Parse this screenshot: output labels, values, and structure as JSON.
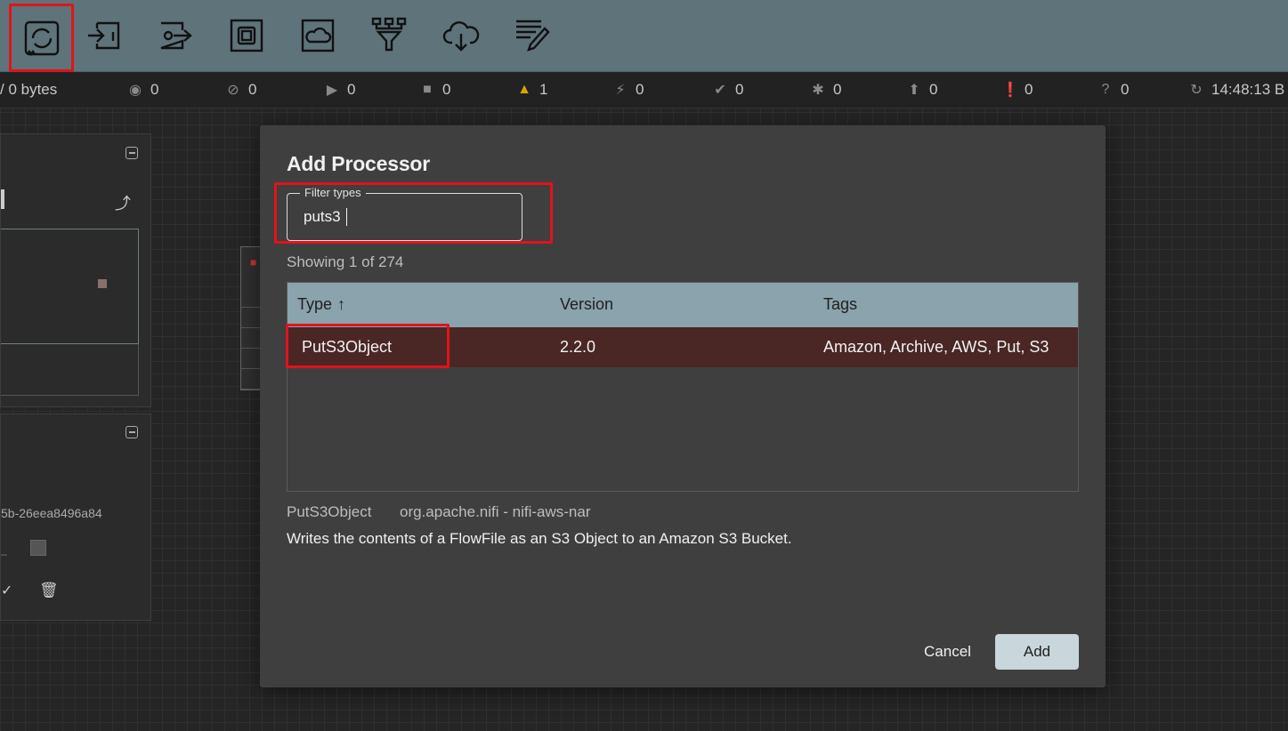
{
  "toolbar": {
    "tools": [
      {
        "name": "processor-icon",
        "selected": true
      },
      {
        "name": "input-port-icon"
      },
      {
        "name": "output-port-icon"
      },
      {
        "name": "process-group-icon"
      },
      {
        "name": "remote-process-group-icon"
      },
      {
        "name": "funnel-icon"
      },
      {
        "name": "template-icon"
      },
      {
        "name": "label-icon"
      }
    ]
  },
  "status": {
    "bytes": "/ 0 bytes",
    "transmitting": "0",
    "not_transmitting": "0",
    "running": "0",
    "stopped": "0",
    "invalid": "1",
    "disabled": "0",
    "up_to_date": "0",
    "locally_modified": "0",
    "stale": "0",
    "errors": "0",
    "sync_failure": "0",
    "last_refreshed": "14:48:13 B"
  },
  "side": {
    "identifier": "5b-26eea8496a84"
  },
  "modal": {
    "title": "Add Processor",
    "filter_label": "Filter types",
    "filter_value": "puts3",
    "showing": "Showing 1 of 274",
    "columns": {
      "type": "Type",
      "version": "Version",
      "tags": "Tags"
    },
    "rows": [
      {
        "type": "PutS3Object",
        "version": "2.2.0",
        "tags": "Amazon, Archive, AWS, Put, S3"
      }
    ],
    "detail": {
      "type": "PutS3Object",
      "bundle": "org.apache.nifi - nifi-aws-nar",
      "description": "Writes the contents of a FlowFile as an S3 Object to an Amazon S3 Bucket."
    },
    "cancel_label": "Cancel",
    "add_label": "Add"
  },
  "colors": {
    "toolbar": "#5f737b",
    "highlight": "#e1131b",
    "table_header": "#8aa3ad",
    "selected_row": "#4a2625",
    "warning": "#d9a400"
  }
}
